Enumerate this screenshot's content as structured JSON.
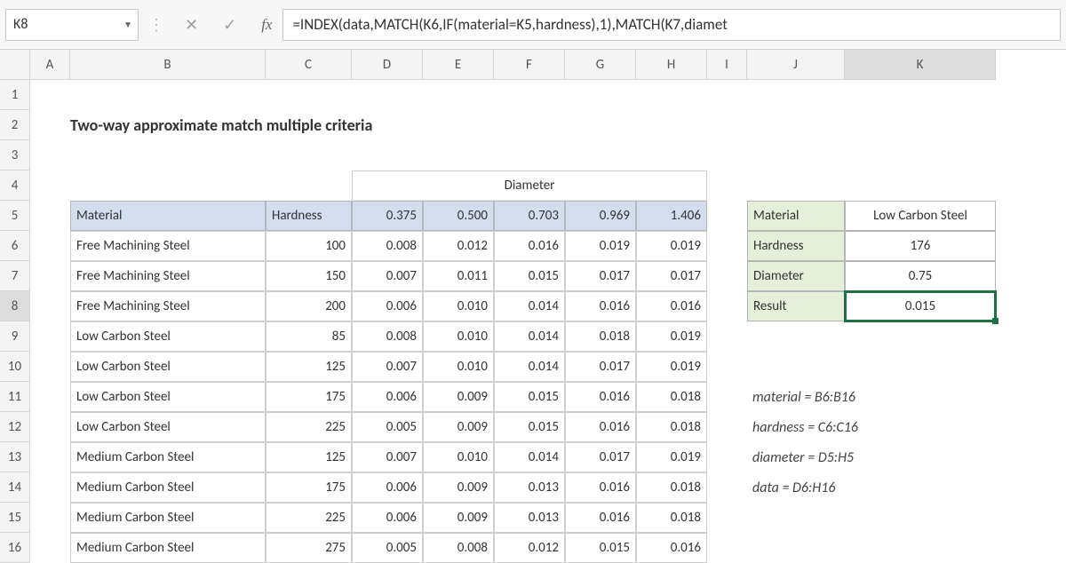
{
  "namebox": "K8",
  "formula": "=INDEX(data,MATCH(K6,IF(material=K5,hardness),1),MATCH(K7,diamet",
  "columns": [
    "A",
    "B",
    "C",
    "D",
    "E",
    "F",
    "G",
    "H",
    "I",
    "J",
    "K"
  ],
  "active_col": "K",
  "active_row": "8",
  "title": "Two-way approximate match multiple criteria",
  "diam_header": "Diameter",
  "headers": {
    "material": "Material",
    "hardness": "Hardness"
  },
  "diam_cols": [
    "0.375",
    "0.500",
    "0.703",
    "0.969",
    "1.406"
  ],
  "rows": [
    {
      "mat": "Free Machining Steel",
      "hard": "100",
      "v": [
        "0.008",
        "0.012",
        "0.016",
        "0.019",
        "0.019"
      ]
    },
    {
      "mat": "Free Machining Steel",
      "hard": "150",
      "v": [
        "0.007",
        "0.011",
        "0.015",
        "0.017",
        "0.017"
      ]
    },
    {
      "mat": "Free Machining Steel",
      "hard": "200",
      "v": [
        "0.006",
        "0.010",
        "0.014",
        "0.016",
        "0.016"
      ]
    },
    {
      "mat": "Low Carbon Steel",
      "hard": "85",
      "v": [
        "0.008",
        "0.010",
        "0.014",
        "0.018",
        "0.019"
      ]
    },
    {
      "mat": "Low Carbon Steel",
      "hard": "125",
      "v": [
        "0.007",
        "0.010",
        "0.014",
        "0.017",
        "0.019"
      ]
    },
    {
      "mat": "Low Carbon Steel",
      "hard": "175",
      "v": [
        "0.006",
        "0.009",
        "0.015",
        "0.016",
        "0.018"
      ]
    },
    {
      "mat": "Low Carbon Steel",
      "hard": "225",
      "v": [
        "0.005",
        "0.009",
        "0.015",
        "0.016",
        "0.018"
      ]
    },
    {
      "mat": "Medium Carbon Steel",
      "hard": "125",
      "v": [
        "0.007",
        "0.010",
        "0.014",
        "0.017",
        "0.019"
      ]
    },
    {
      "mat": "Medium Carbon Steel",
      "hard": "175",
      "v": [
        "0.006",
        "0.009",
        "0.013",
        "0.016",
        "0.018"
      ]
    },
    {
      "mat": "Medium Carbon Steel",
      "hard": "225",
      "v": [
        "0.006",
        "0.009",
        "0.013",
        "0.016",
        "0.018"
      ]
    },
    {
      "mat": "Medium Carbon Steel",
      "hard": "275",
      "v": [
        "0.005",
        "0.008",
        "0.012",
        "0.015",
        "0.016"
      ]
    }
  ],
  "lookup": {
    "material_l": "Material",
    "material_v": "Low Carbon Steel",
    "hardness_l": "Hardness",
    "hardness_v": "176",
    "diameter_l": "Diameter",
    "diameter_v": "0.75",
    "result_l": "Result",
    "result_v": "0.015"
  },
  "notes": [
    "material = B6:B16",
    "hardness = C6:C16",
    "diameter = D5:H5",
    "data = D6:H16"
  ]
}
